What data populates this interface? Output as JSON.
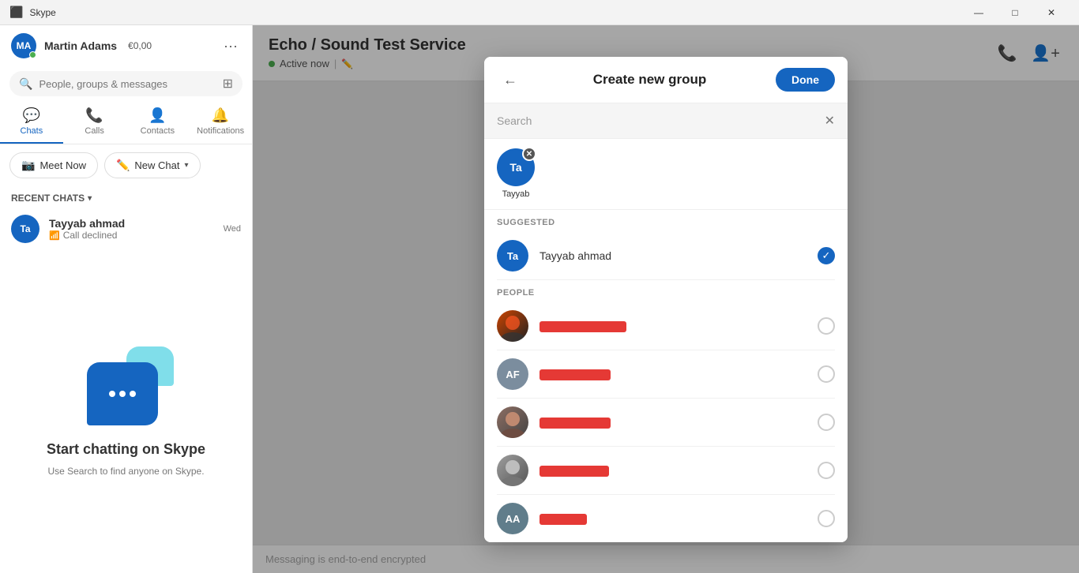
{
  "titleBar": {
    "appName": "Skype",
    "minimize": "—",
    "maximize": "□",
    "close": "✕"
  },
  "sidebar": {
    "profile": {
      "initials": "MA",
      "name": "Martin Adams",
      "balance": "€0,00"
    },
    "search": {
      "placeholder": "People, groups & messages"
    },
    "navTabs": [
      {
        "label": "Chats",
        "icon": "💬",
        "active": true
      },
      {
        "label": "Calls",
        "icon": "📞",
        "active": false
      },
      {
        "label": "Contacts",
        "icon": "👤",
        "active": false
      },
      {
        "label": "Notifications",
        "icon": "🔔",
        "active": false
      }
    ],
    "actions": {
      "meetNow": "Meet Now",
      "newChat": "New Chat"
    },
    "recentChats": {
      "sectionLabel": "RECENT CHATS",
      "items": [
        {
          "initials": "Ta",
          "name": "Tayyab ahmad",
          "preview": "Call declined",
          "time": "Wed"
        }
      ]
    },
    "illustration": {
      "title": "Start chatting on Skype",
      "desc": "Use Search to find anyone on\nSkype."
    }
  },
  "mainContent": {
    "title": "Echo / Sound Test Service",
    "status": "Active now",
    "footerText": "Messaging is end-to-end encrypted"
  },
  "modal": {
    "title": "Create new group",
    "doneLabel": "Done",
    "searchPlaceholder": "Search",
    "selectedContacts": [
      {
        "initials": "Ta",
        "name": "Tayyab",
        "color": "#1565c0"
      }
    ],
    "suggestedLabel": "SUGGESTED",
    "suggested": [
      {
        "initials": "Ta",
        "name": "Tayyab ahmad",
        "checked": true,
        "color": "#1565c0",
        "type": "initials"
      }
    ],
    "peopleLabel": "PEOPLE",
    "people": [
      {
        "initials": "",
        "name": "",
        "checked": false,
        "color": "#ff5722",
        "type": "image1"
      },
      {
        "initials": "AF",
        "name": "",
        "checked": false,
        "color": "#7b8d9e",
        "type": "initials"
      },
      {
        "initials": "",
        "name": "",
        "checked": false,
        "color": "#9e9e9e",
        "type": "image2"
      },
      {
        "initials": "",
        "name": "",
        "checked": false,
        "color": "#8d6e63",
        "type": "image3"
      },
      {
        "initials": "AA",
        "name": "",
        "checked": false,
        "color": "#607d8b",
        "type": "initials"
      }
    ],
    "redactedWidths": [
      110,
      90,
      90,
      88,
      60
    ]
  }
}
